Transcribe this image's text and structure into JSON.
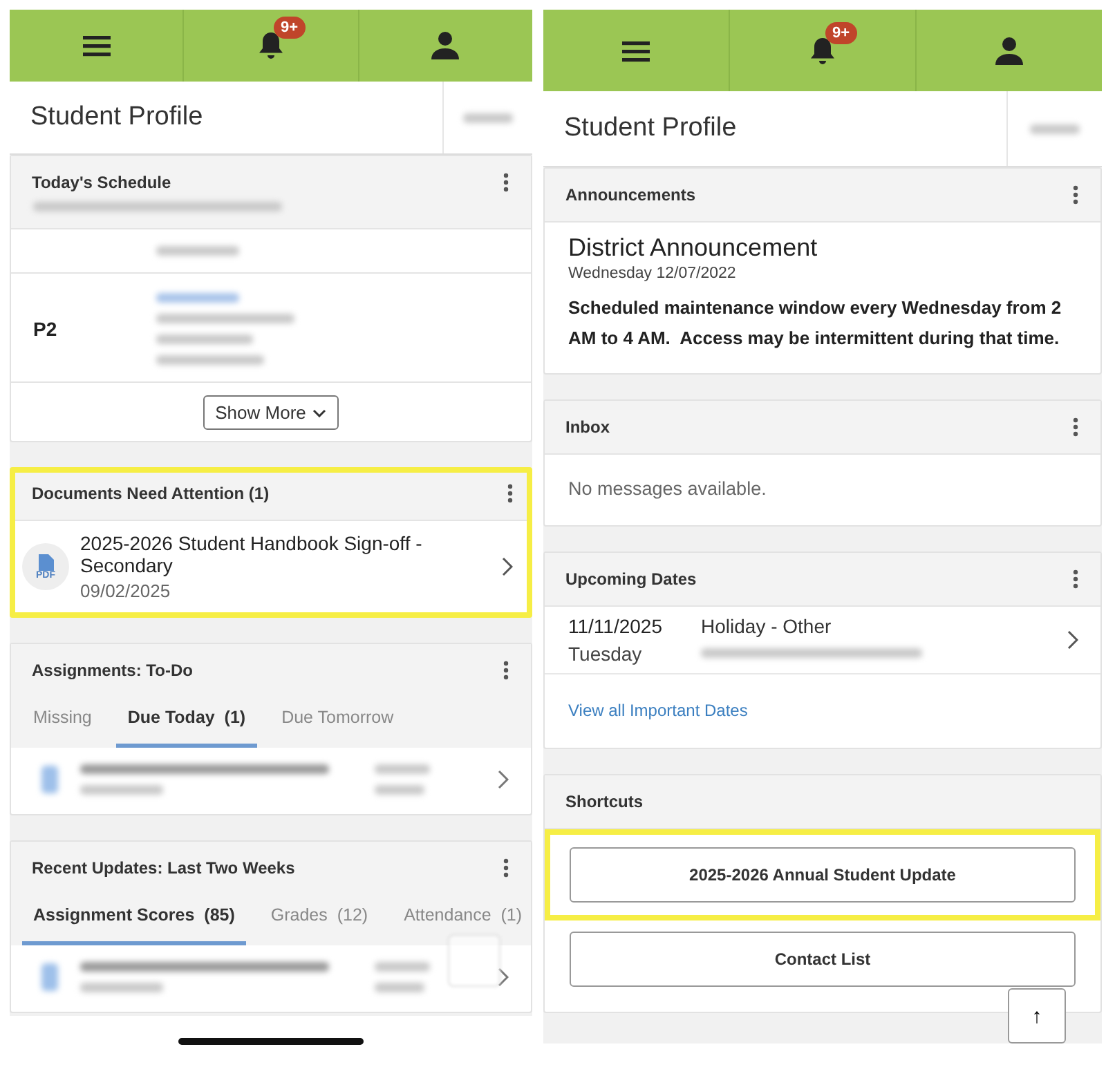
{
  "screens": [
    {
      "badge": "9+",
      "title": "Student Profile",
      "scroll_button": false,
      "home_indicator": true,
      "cards": [
        {
          "kind": "schedule",
          "title": "Today's Schedule",
          "period": "P2",
          "button": "Show More",
          "highlighted": false
        },
        {
          "kind": "document",
          "title": "Documents Need Attention (1)",
          "item_title": "2025-2026 Student Handbook Sign-off - Secondary",
          "item_date": "09/02/2025",
          "icon_label": "PDF",
          "highlighted": true
        },
        {
          "kind": "tabs",
          "title": "Assignments: To-Do",
          "highlighted": false,
          "tabs": [
            {
              "label": "Missing",
              "selected": false
            },
            {
              "label": "Due Today  (1)",
              "selected": true
            },
            {
              "label": "Due Tomorrow",
              "selected": false
            }
          ]
        },
        {
          "kind": "tabs",
          "title": "Recent Updates: Last Two Weeks",
          "highlighted": false,
          "tabs": [
            {
              "label": "Assignment Scores  (85)",
              "selected": true
            },
            {
              "label": "Grades  (12)",
              "selected": false
            },
            {
              "label": "Attendance  (1)",
              "selected": false
            }
          ]
        }
      ]
    },
    {
      "badge": "9+",
      "title": "Student Profile",
      "scroll_button": "↑",
      "home_indicator": false,
      "cards": [
        {
          "kind": "announcement",
          "title": "Announcements",
          "heading": "District Announcement",
          "date": "Wednesday 12/07/2022",
          "body": "Scheduled maintenance window every Wednesday from 2 AM to 4 AM.  Access may be intermittent during that time.",
          "highlighted": false
        },
        {
          "kind": "message",
          "title": "Inbox",
          "message": "No messages available.",
          "highlighted": false
        },
        {
          "kind": "dates",
          "title": "Upcoming Dates",
          "events": [
            {
              "date": "11/11/2025",
              "day": "Tuesday",
              "name": "Holiday - Other"
            }
          ],
          "link": "View all Important Dates",
          "highlighted": false
        },
        {
          "kind": "shortcuts",
          "title": "Shortcuts",
          "highlighted": false,
          "buttons": [
            {
              "label": "2025-2026 Annual Student Update",
              "highlighted": true
            },
            {
              "label": "Contact List",
              "highlighted": false
            }
          ]
        }
      ]
    }
  ]
}
